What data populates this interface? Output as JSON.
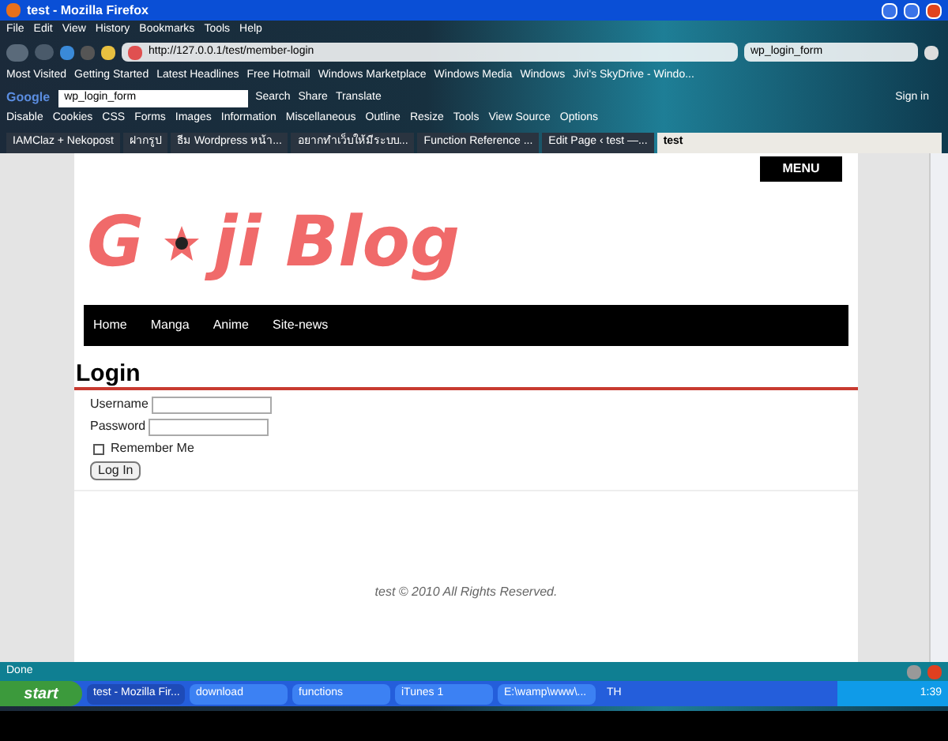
{
  "window": {
    "title": "test - Mozilla Firefox"
  },
  "menu_bar": [
    "File",
    "Edit",
    "View",
    "History",
    "Bookmarks",
    "Tools",
    "Help"
  ],
  "address_bar": {
    "value": "http://127.0.0.1/test/member-login"
  },
  "search_box": {
    "value": "wp_login_form"
  },
  "bookmarks": [
    "Most Visited",
    "Getting Started",
    "Latest Headlines",
    "Free Hotmail",
    "Windows Marketplace",
    "Windows Media",
    "Windows",
    "Jivi's SkyDrive - Windo..."
  ],
  "google_toolbar": {
    "logo": "Google",
    "query": "wp_login_form",
    "buttons": [
      "Search",
      "Share",
      "Translate"
    ],
    "sign_in": "Sign in"
  },
  "developer_toolbar": [
    "Disable",
    "Cookies",
    "CSS",
    "Forms",
    "Images",
    "Information",
    "Miscellaneous",
    "Outline",
    "Resize",
    "Tools",
    "View Source",
    "Options"
  ],
  "tabs": [
    {
      "label": "IAMClaz + Nekopost",
      "selected": false
    },
    {
      "label": "ฝากรูป",
      "selected": false
    },
    {
      "label": "ธีม Wordpress หน้า...",
      "selected": false
    },
    {
      "label": "อยากทำเว็บให้มีระบบ...",
      "selected": false
    },
    {
      "label": "Function Reference ...",
      "selected": false
    },
    {
      "label": "Edit Page ‹ test —...",
      "selected": false
    },
    {
      "label": "test",
      "selected": true
    }
  ],
  "page": {
    "menu_button": "MENU",
    "logo": {
      "before": "G",
      "after": "ji Blog"
    },
    "nav": [
      "Home",
      "Manga",
      "Anime",
      "Site-news"
    ],
    "heading": "Login",
    "form": {
      "username_label": "Username",
      "password_label": "Password",
      "remember": {
        "label": "Remember Me",
        "checked": false
      },
      "submit": "Log In"
    },
    "footer": "test © 2010 All Rights Reserved."
  },
  "status_bar": {
    "text": "Done"
  },
  "taskbar": {
    "start": "start",
    "items": [
      {
        "label": "test - Mozilla Fir...",
        "selected": true
      },
      {
        "label": "download",
        "selected": false
      },
      {
        "label": "functions",
        "selected": false
      },
      {
        "label": "iTunes 1",
        "selected": false
      },
      {
        "label": "E:\\wamp\\www\\...",
        "selected": false
      }
    ],
    "language": "TH",
    "clock": "1:39"
  }
}
